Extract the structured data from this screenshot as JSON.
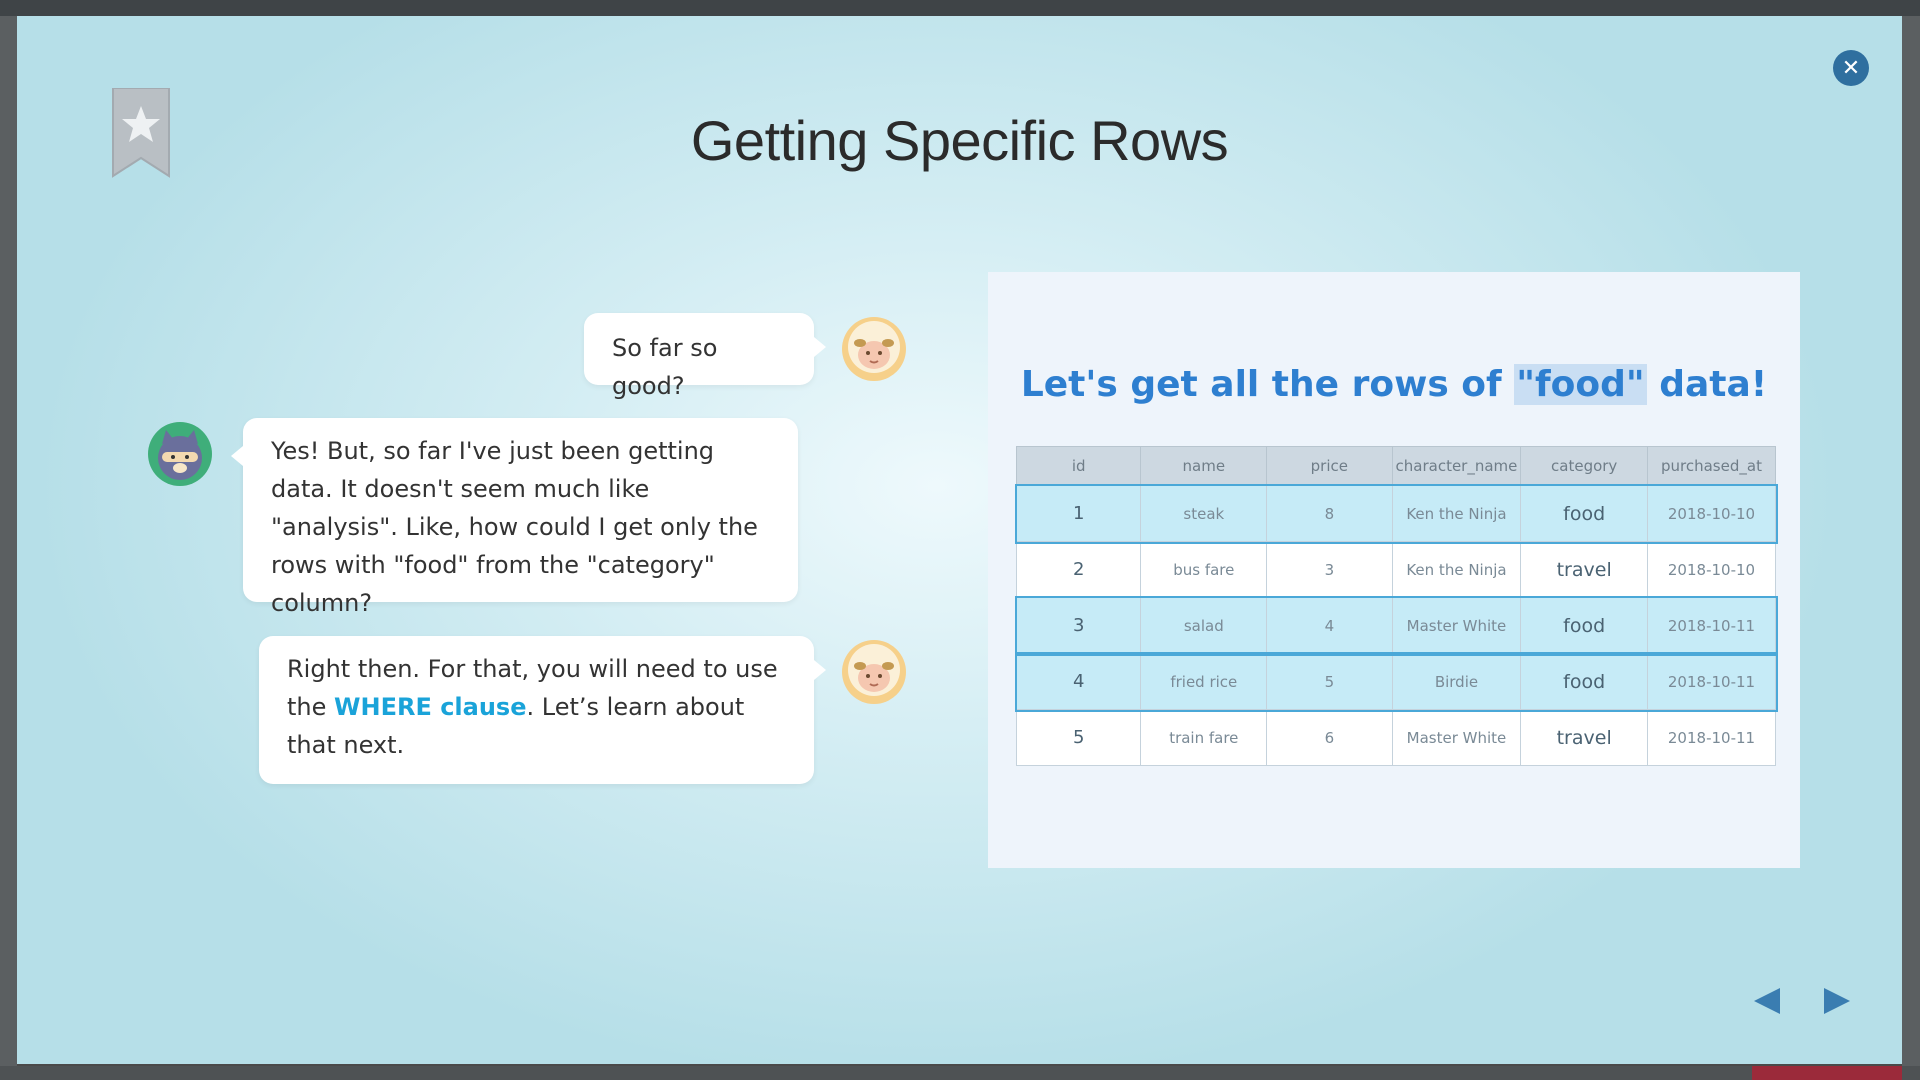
{
  "lesson": {
    "title": "Getting Specific Rows"
  },
  "conversation": [
    {
      "speaker": "sheep",
      "text": "So far so good?"
    },
    {
      "speaker": "ninja-cat",
      "text": "Yes! But, so far I've just been getting data. It doesn't seem much like \"analysis\". Like, how could I get only the rows with \"food\" from the \"category\" column?"
    },
    {
      "speaker": "sheep",
      "text_before": "Right then. For that, you will need to use the ",
      "keyword": "WHERE clause",
      "text_after": ". Let’s learn about that next."
    }
  ],
  "panel": {
    "heading_before": "Let's get all the rows of ",
    "heading_highlight": "\"food\"",
    "heading_after": " data!"
  },
  "table": {
    "columns": [
      "id",
      "name",
      "price",
      "character_name",
      "category",
      "purchased_at"
    ],
    "rows": [
      [
        "1",
        "steak",
        "8",
        "Ken the Ninja",
        "food",
        "2018-10-10"
      ],
      [
        "2",
        "bus fare",
        "3",
        "Ken the Ninja",
        "travel",
        "2018-10-10"
      ],
      [
        "3",
        "salad",
        "4",
        "Master White",
        "food",
        "2018-10-11"
      ],
      [
        "4",
        "fried rice",
        "5",
        "Birdie",
        "food",
        "2018-10-11"
      ],
      [
        "5",
        "train fare",
        "6",
        "Master White",
        "travel",
        "2018-10-11"
      ]
    ],
    "highlighted_category": "food"
  },
  "colors": {
    "accent_blue": "#2e7fd0",
    "keyword": "#1aa3d9",
    "close_button": "#2f6f9f",
    "row_highlight": "#c6ebf7"
  },
  "icons": {
    "close": "close-icon",
    "bookmark": "bookmark-star-icon",
    "prev": "prev-arrow-icon",
    "next": "next-arrow-icon"
  }
}
